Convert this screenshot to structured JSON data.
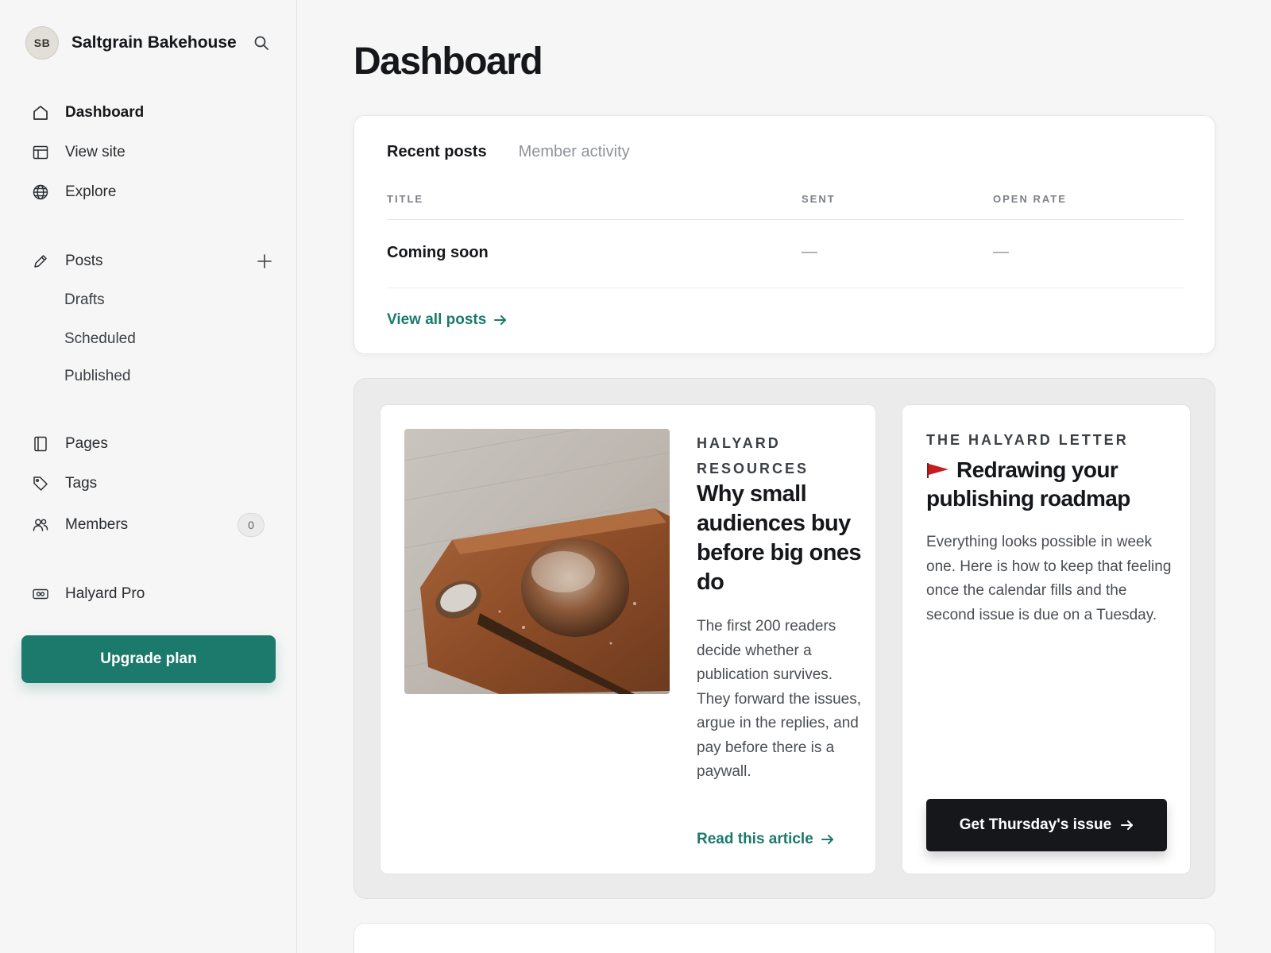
{
  "site": {
    "initials": "SB",
    "name": "Saltgrain Bakehouse"
  },
  "sidebar": {
    "items": [
      {
        "label": "Dashboard",
        "icon": "home-icon"
      },
      {
        "label": "View site",
        "icon": "layout-icon"
      },
      {
        "label": "Explore",
        "icon": "globe-icon"
      },
      {
        "label": "Posts",
        "icon": "pencil-icon"
      },
      {
        "label": "Pages",
        "icon": "page-icon"
      },
      {
        "label": "Tags",
        "icon": "tag-icon"
      },
      {
        "label": "Members",
        "icon": "members-icon"
      },
      {
        "label": "Halyard Pro",
        "icon": "pro-icon"
      }
    ],
    "post_subitems": [
      "Drafts",
      "Scheduled",
      "Published"
    ],
    "members_count": "0",
    "upgrade_label": "Upgrade plan"
  },
  "main": {
    "title": "Dashboard",
    "posts_card": {
      "tabs": [
        "Recent posts",
        "Member activity"
      ],
      "columns": [
        "TITLE",
        "SENT",
        "OPEN RATE"
      ],
      "rows": [
        {
          "title": "Coming soon",
          "sent": "—",
          "open_rate": "—"
        }
      ],
      "view_all": "View all posts"
    },
    "article": {
      "kicker": "HALYARD RESOURCES",
      "title": "Why small audiences buy before big ones do",
      "body": "The first 200 readers decide whether a publication survives. They forward the issues, argue in the replies, and pay before there is a paywall.",
      "link": "Read this article"
    },
    "letter": {
      "kicker": "THE HALYARD LETTER",
      "title": "Redrawing your publishing roadmap",
      "body": "Everything looks possible in week one. Here is how to keep that feeling once the calendar fills and the second issue is due on a Tuesday.",
      "button": "Get Thursday's issue"
    }
  },
  "colors": {
    "accent": "#1b7a6b",
    "text": "#15171a",
    "background": "#f6f6f6"
  }
}
